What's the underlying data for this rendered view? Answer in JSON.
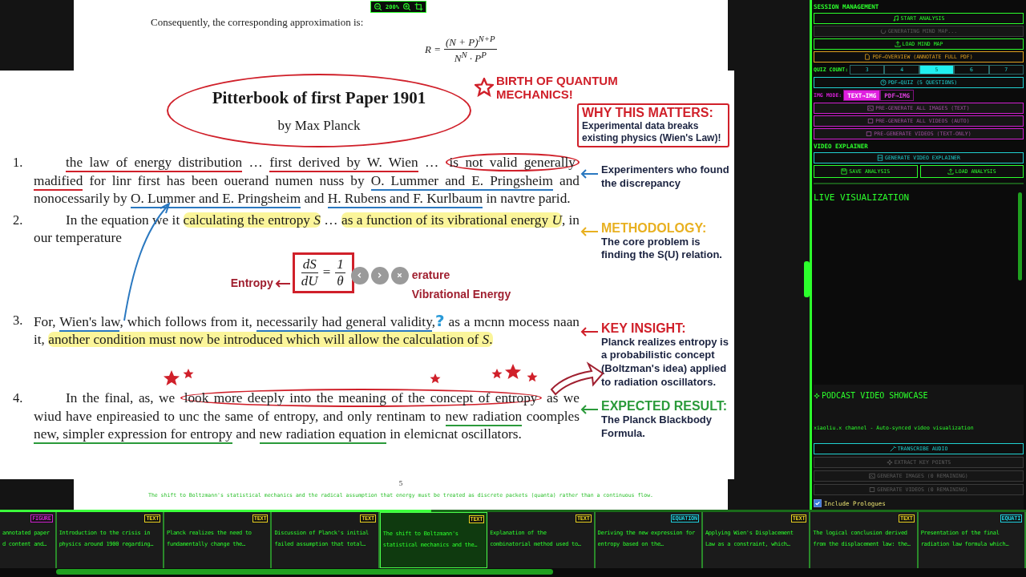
{
  "toolbar": {
    "zoom": "200%"
  },
  "page_top": {
    "text": "Consequently, the corresponding approximation is:",
    "lhs": "R =",
    "numerator": "(N + P)$^{N+P}$",
    "denominator": "N$^{N}$ · P$^{P}$"
  },
  "figure": {
    "title": "Pitterbook of first Paper 1901",
    "byline": "by Max Planck",
    "birth_callout": "BIRTH OF QUANTUM MECHANICS!",
    "why": {
      "title": "WHY THIS MATTERS:",
      "text": "Experimental data breaks existing physics (Wien's Law)!"
    },
    "items": [
      {
        "number": "1.",
        "indent": true,
        "segments": [
          {
            "kind": "underline",
            "text": "the law of energy distribution",
            "color": "#d0202a"
          },
          {
            "kind": "plain",
            "text": " … "
          },
          {
            "kind": "underline",
            "text": "first derived by W. Wien",
            "color": "#d0202a"
          },
          {
            "kind": "plain",
            "text": " … "
          },
          {
            "kind": "circled",
            "text": "is not valid generally",
            "color": "#d0202a"
          },
          {
            "kind": "underline",
            "text": " madified",
            "color": "#d0202a"
          },
          {
            "kind": "plain",
            "text": " for linr first has been ouerand numen nuss by "
          },
          {
            "kind": "underline",
            "text": "O. Lummer and E. Pringsheim",
            "color": "#2a78c0"
          },
          {
            "kind": "plain",
            "text": " and nonocessarily by "
          },
          {
            "kind": "underline",
            "text": "O. Lummer and E. Pringsheim",
            "color": "#2a78c0"
          },
          {
            "kind": "plain",
            "text": " and "
          },
          {
            "kind": "underline",
            "text": "H. Rubens and F. Kurlbaum",
            "color": "#2a78c0"
          },
          {
            "kind": "plain",
            "text": " in navtre parid."
          }
        ],
        "callout": {
          "text": "Experimenters who found the discrepancy",
          "color": "#2a78c0"
        }
      },
      {
        "number": "2.",
        "indent": true,
        "segments": [
          {
            "kind": "plain",
            "text": "In the equation we it "
          },
          {
            "kind": "highlight",
            "text": "calculating the entropy *S*",
            "color": "#fbf59a"
          },
          {
            "kind": "plain",
            "text": " … "
          },
          {
            "kind": "highlight",
            "text": "as a function of its vibrational energy *U*",
            "color": "#fbf59a"
          },
          {
            "kind": "plain",
            "text": ", in our temperature"
          }
        ],
        "equation": {
          "lhs_num": "dS",
          "lhs_den": "dU",
          "sign": "=",
          "rhs_num": "1",
          "rhs_den": "θ",
          "left_label": "Entropy",
          "right_label": "erature",
          "bottom_label": "Vibrational Energy"
        },
        "callout": {
          "title": "METHODOLOGY:",
          "text": "The core problem is finding the S(U) relation.",
          "color": "#e8b020"
        }
      },
      {
        "number": "3.",
        "indent": false,
        "segments": [
          {
            "kind": "plain",
            "text": "For, "
          },
          {
            "kind": "underline",
            "text": "Wien's law",
            "color": "#2a78c0"
          },
          {
            "kind": "plain",
            "text": ", which follows from it, "
          },
          {
            "kind": "underline",
            "text": "necessarily had general validity",
            "color": "#2a78c0"
          },
          {
            "kind": "plain",
            "text": ","
          },
          {
            "kind": "mark",
            "text": "?",
            "color": "#2a9ad8"
          },
          {
            "kind": "plain",
            "text": " as a mcnn mocess naan it, "
          },
          {
            "kind": "highlight",
            "text": "another condition must now be introduced which will allow the calculation of *S*.",
            "color": "#fbf59a"
          }
        ],
        "callout": {
          "title": "KEY INSIGHT:",
          "text": "Planck realizes entropy is a probabilistic concept (Boltzman's idea) applied to radiation oscillators.",
          "color": "#d0202a"
        }
      },
      {
        "number": "4.",
        "indent": true,
        "segments": [
          {
            "kind": "plain",
            "text": "In the final, as, we "
          },
          {
            "kind": "circled",
            "text": "look more deeply into the meaning of the concept of entropy",
            "color": "#d0202a"
          },
          {
            "kind": "plain",
            "text": " as we wiud have enpireasied to unc the same of entropy, and only rentinam to "
          },
          {
            "kind": "underline",
            "text": "new radiation",
            "color": "#2a9a3a"
          },
          {
            "kind": "plain",
            "text": " coomples "
          },
          {
            "kind": "underline",
            "text": "new, simpler expression for entropy",
            "color": "#2a9a3a"
          },
          {
            "kind": "plain",
            "text": " and "
          },
          {
            "kind": "underline",
            "text": "new radiation equation",
            "color": "#2a9a3a"
          },
          {
            "kind": "plain",
            "text": " in elemicnat oscillators."
          }
        ],
        "callout": {
          "title": "EXPECTED RESULT:",
          "text": "The Planck Blackbody Formula.",
          "color": "#2a9a3a"
        }
      }
    ]
  },
  "page_bottom": {
    "page_number": "5",
    "caption": "The shift to Boltzmann's statistical mechanics and the radical assumption that energy must be treated as discrete packets (quanta) rather than a continuous flow."
  },
  "panel": {
    "session_title": "SESSION MANAGEMENT",
    "session_buttons": [
      {
        "label": "START ANALYSIS",
        "color": "#2cff2c",
        "disabled": false
      },
      {
        "label": "GENERATING MIND MAP...",
        "color": "#3a3a3a",
        "disabled": true
      },
      {
        "label": "LOAD MIND MAP",
        "color": "#2cff2c",
        "disabled": false
      },
      {
        "label": "PDF→OVERVIEW (ANNOTATE FULL PDF)",
        "color": "#e0a020",
        "disabled": false
      }
    ],
    "quiz": {
      "label": "QUIZ COUNT:",
      "options": [
        {
          "label": "3",
          "selected": false
        },
        {
          "label": "4",
          "selected": false
        },
        {
          "label": "5",
          "selected": true
        },
        {
          "label": "6",
          "selected": false
        },
        {
          "label": "7",
          "selected": false
        }
      ]
    },
    "quiz_button": {
      "label": "PDF→QUIZ (5 QUESTIONS)",
      "color": "#20d0d0",
      "disabled": false
    },
    "img_mode": {
      "label": "IMG MODE:",
      "options": [
        {
          "label": "TEXT→IMG",
          "selected": true
        },
        {
          "label": "PDF→IMG",
          "selected": false
        }
      ]
    },
    "img_buttons": [
      {
        "label": "PRE-GENERATE ALL IMAGES (TEXT)",
        "color": "#d020d0",
        "disabled": true
      },
      {
        "label": "PRE-GENERATE ALL VIDEOS (AUTO)",
        "color": "#d020d0",
        "disabled": true
      },
      {
        "label": "PRE-GENERATE VIDEOS (TEXT-ONLY)",
        "color": "#d020d0",
        "disabled": true
      }
    ],
    "video_title": "VIDEO EXPLAINER",
    "video_button": {
      "label": "GENERATE VIDEO EXPLAINER",
      "color": "#20d0d0",
      "disabled": false
    },
    "save_buttons": [
      {
        "label": "SAVE ANALYSIS",
        "color": "#2cff2c",
        "disabled": false
      },
      {
        "label": "LOAD ANALYSIS",
        "color": "#2cff2c",
        "disabled": false
      }
    ],
    "live_title": "LIVE VISUALIZATION",
    "podcast": {
      "title": "PODCAST VIDEO SHOWCASE",
      "subtitle": "xiaoliu.x channel - Auto-synced video visualization",
      "buttons": [
        {
          "label": "TRANSCRIBE AUDIO",
          "color": "#20d0d0",
          "disabled": false
        },
        {
          "label": "EXTRACT KEY POINTS",
          "color": "#3a3a3a",
          "disabled": true
        },
        {
          "label": "GENERATE IMAGES (0 REMAINING)",
          "color": "#3a3a3a",
          "disabled": true
        },
        {
          "label": "GENERATE VIDEOS (0 REMAINING)",
          "color": "#3a3a3a",
          "disabled": true
        }
      ],
      "checkbox": {
        "label": "Include Prologues",
        "checked": true
      }
    }
  },
  "strip": {
    "progress": {
      "level": 0.42
    },
    "cards": [
      {
        "kind": "figure",
        "tag": "FIGURE",
        "lines": [
          "annotated paper",
          "d content and…"
        ],
        "selected": false
      },
      {
        "kind": "text",
        "tag": "TEXT",
        "lines": [
          "Introduction to the crisis in",
          "physics around 1900 regarding…"
        ],
        "selected": false
      },
      {
        "kind": "text",
        "tag": "TEXT",
        "lines": [
          "Planck realizes the need to",
          "fundamentally change the…"
        ],
        "selected": false
      },
      {
        "kind": "text",
        "tag": "TEXT",
        "lines": [
          "Discussion of Planck's initial",
          "failed assumption that total…"
        ],
        "selected": false
      },
      {
        "kind": "text",
        "tag": "TEXT",
        "lines": [
          "The shift to Boltzmann's",
          "statistical mechanics and the…"
        ],
        "selected": true
      },
      {
        "kind": "text",
        "tag": "TEXT",
        "lines": [
          "Explanation of the",
          "combinatorial method used to…"
        ],
        "selected": false
      },
      {
        "kind": "equation",
        "tag": "EQUATION",
        "lines": [
          "Deriving the new expression for",
          "entropy based on the…"
        ],
        "selected": false
      },
      {
        "kind": "text",
        "tag": "TEXT",
        "lines": [
          "Applying Wien's Displacement",
          "Law as a constraint, which…"
        ],
        "selected": false
      },
      {
        "kind": "text",
        "tag": "TEXT",
        "lines": [
          "The logical conclusion derived",
          "from the displacement law: the…"
        ],
        "selected": false
      },
      {
        "kind": "equation",
        "tag": "EQUATI",
        "lines": [
          "Presentation of the final",
          "radiation law formula which…"
        ],
        "selected": false
      }
    ]
  }
}
